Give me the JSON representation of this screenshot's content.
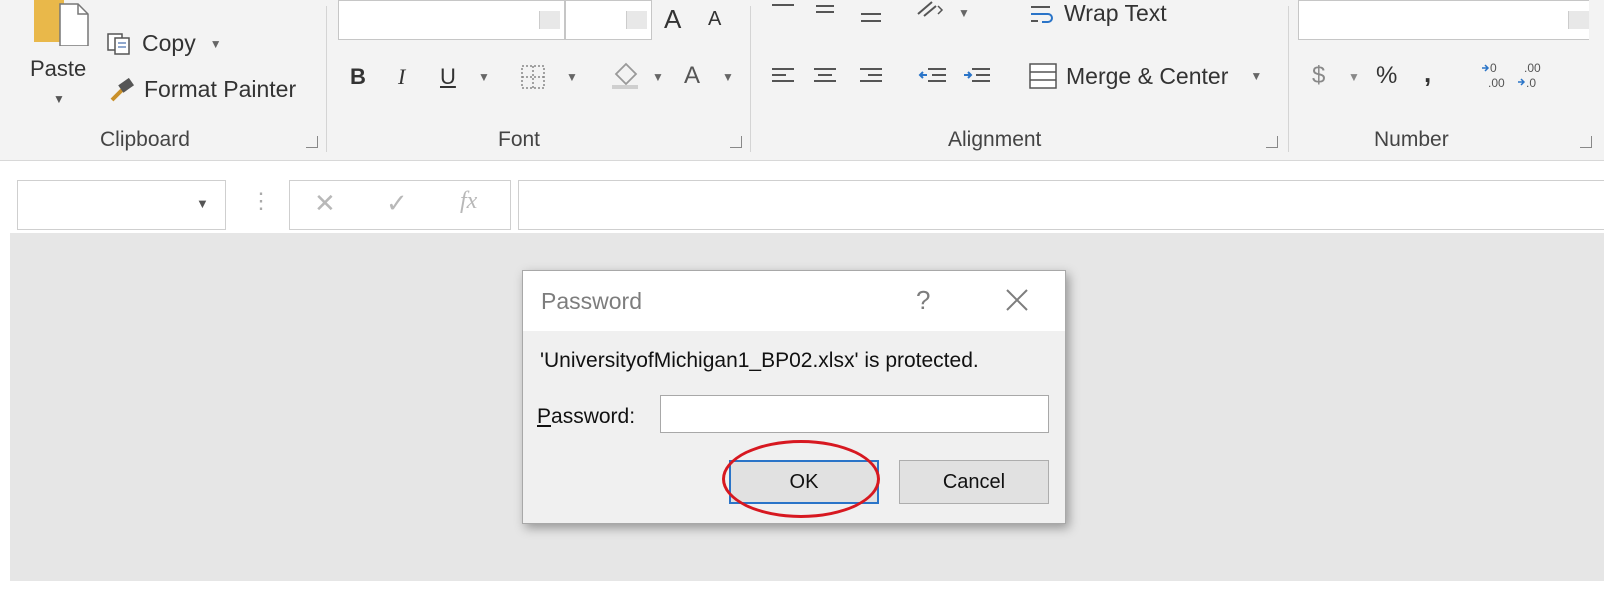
{
  "ribbon": {
    "clipboard": {
      "group_label": "Clipboard",
      "paste_label": "Paste",
      "copy_label": "Copy",
      "format_painter_label": "Format Painter"
    },
    "font": {
      "group_label": "Font",
      "bold": "B",
      "italic": "I",
      "underline": "U",
      "grow_font": "A",
      "shrink_font": "A",
      "font_color": "A"
    },
    "alignment": {
      "group_label": "Alignment",
      "wrap_text_label": "Wrap Text",
      "merge_center_label": "Merge & Center"
    },
    "number": {
      "group_label": "Number",
      "currency": "$",
      "percent": "%",
      "comma": ","
    }
  },
  "formula_bar": {
    "cancel_symbol": "✕",
    "enter_symbol": "✓",
    "fx_symbol": "fx"
  },
  "dialog": {
    "title": "Password",
    "help": "?",
    "message": "'UniversityofMichigan1_BP02.xlsx' is protected.",
    "password_label_accel": "P",
    "password_label_rest": "assword:",
    "password_value": "",
    "ok_label": "OK",
    "cancel_label": "Cancel"
  },
  "colors": {
    "ok_highlight_ring": "#d71820",
    "ok_focus_border": "#2a74c8"
  }
}
